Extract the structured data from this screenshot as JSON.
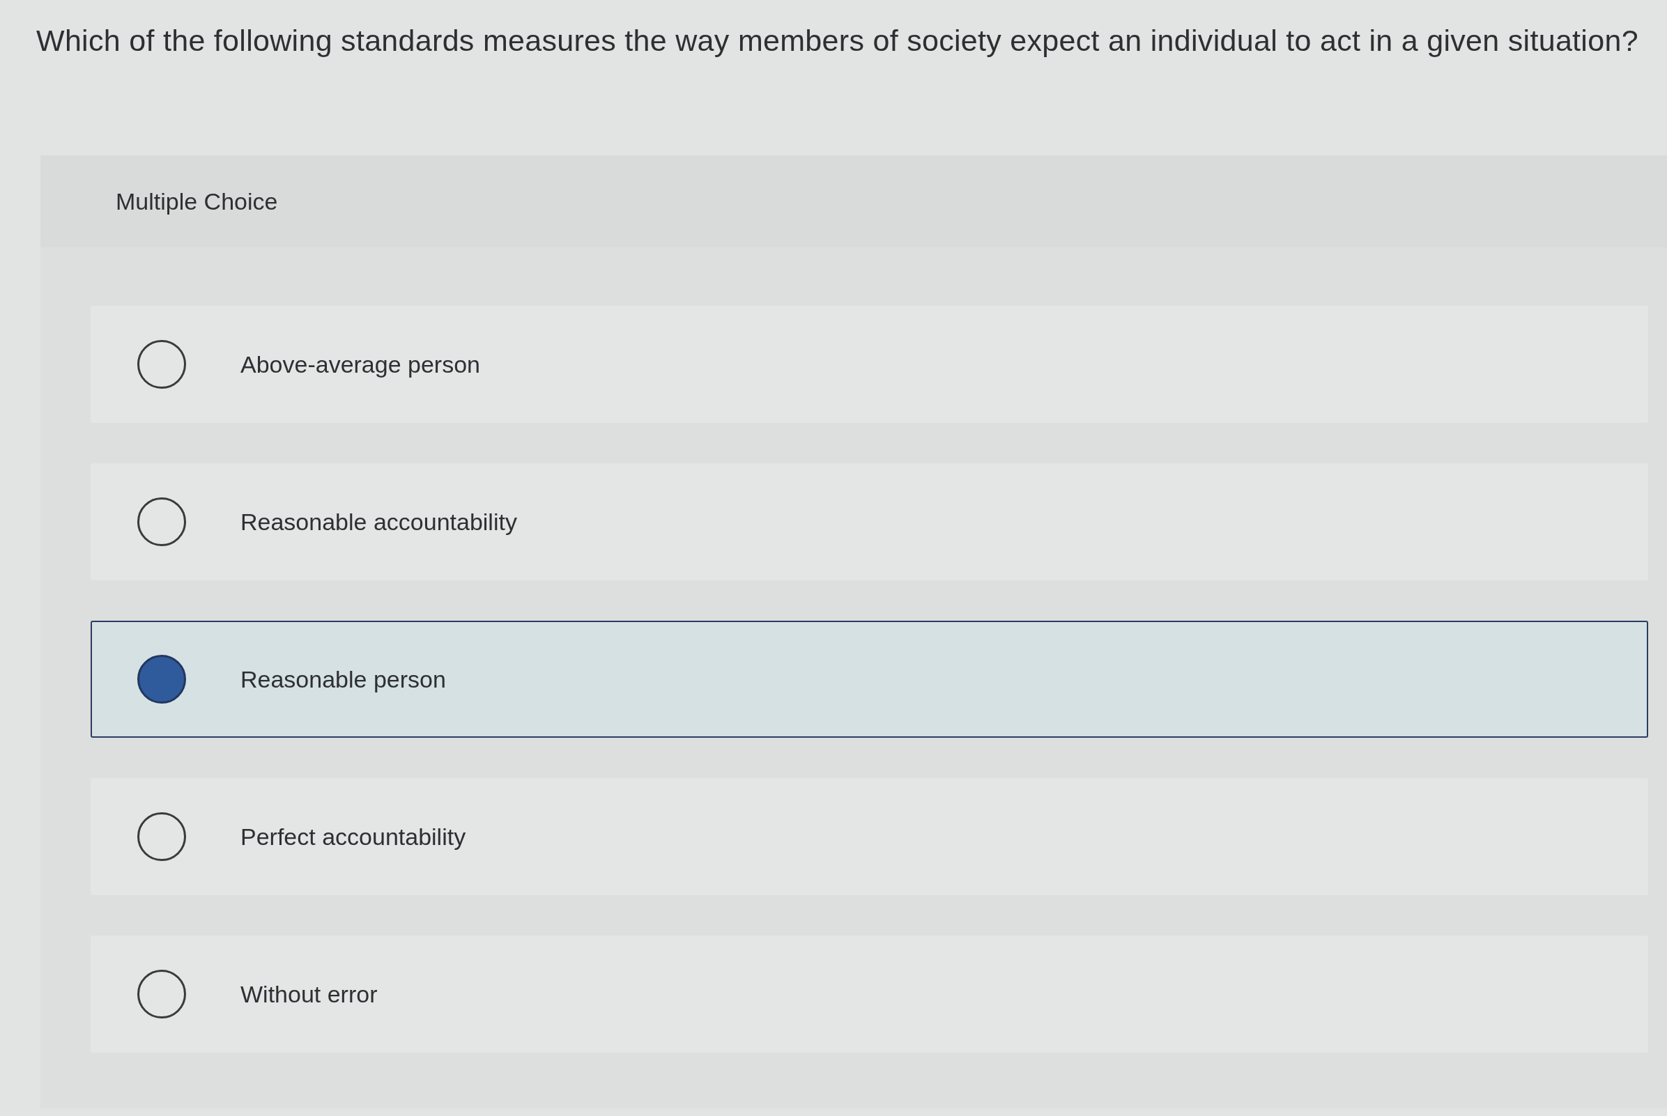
{
  "question": "Which of the following standards measures the way members of society expect an individual to act in a given situation?",
  "panel": {
    "heading": "Multiple Choice",
    "options": [
      {
        "label": "Above-average person",
        "selected": false
      },
      {
        "label": "Reasonable accountability",
        "selected": false
      },
      {
        "label": "Reasonable person",
        "selected": true
      },
      {
        "label": "Perfect accountability",
        "selected": false
      },
      {
        "label": "Without error",
        "selected": false
      }
    ]
  }
}
